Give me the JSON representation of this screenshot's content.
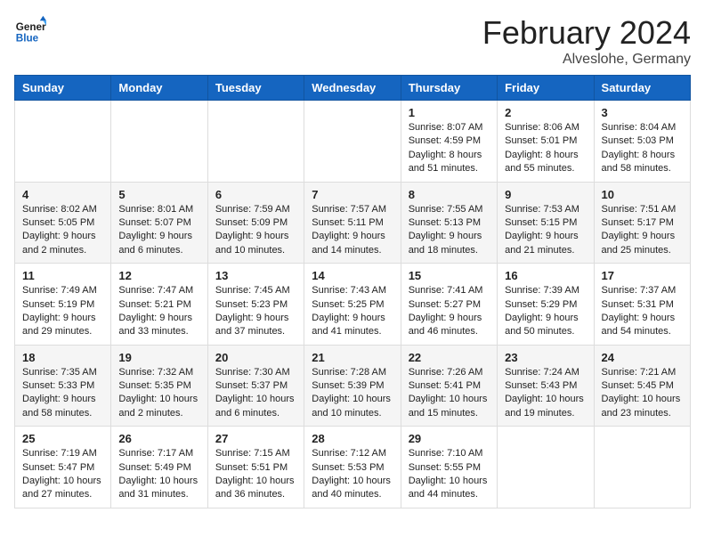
{
  "header": {
    "logo_general": "General",
    "logo_blue": "Blue",
    "month_title": "February 2024",
    "location": "Alveslohe, Germany"
  },
  "weekdays": [
    "Sunday",
    "Monday",
    "Tuesday",
    "Wednesday",
    "Thursday",
    "Friday",
    "Saturday"
  ],
  "weeks": [
    [
      {
        "day": "",
        "info": ""
      },
      {
        "day": "",
        "info": ""
      },
      {
        "day": "",
        "info": ""
      },
      {
        "day": "",
        "info": ""
      },
      {
        "day": "1",
        "info": "Sunrise: 8:07 AM\nSunset: 4:59 PM\nDaylight: 8 hours\nand 51 minutes."
      },
      {
        "day": "2",
        "info": "Sunrise: 8:06 AM\nSunset: 5:01 PM\nDaylight: 8 hours\nand 55 minutes."
      },
      {
        "day": "3",
        "info": "Sunrise: 8:04 AM\nSunset: 5:03 PM\nDaylight: 8 hours\nand 58 minutes."
      }
    ],
    [
      {
        "day": "4",
        "info": "Sunrise: 8:02 AM\nSunset: 5:05 PM\nDaylight: 9 hours\nand 2 minutes."
      },
      {
        "day": "5",
        "info": "Sunrise: 8:01 AM\nSunset: 5:07 PM\nDaylight: 9 hours\nand 6 minutes."
      },
      {
        "day": "6",
        "info": "Sunrise: 7:59 AM\nSunset: 5:09 PM\nDaylight: 9 hours\nand 10 minutes."
      },
      {
        "day": "7",
        "info": "Sunrise: 7:57 AM\nSunset: 5:11 PM\nDaylight: 9 hours\nand 14 minutes."
      },
      {
        "day": "8",
        "info": "Sunrise: 7:55 AM\nSunset: 5:13 PM\nDaylight: 9 hours\nand 18 minutes."
      },
      {
        "day": "9",
        "info": "Sunrise: 7:53 AM\nSunset: 5:15 PM\nDaylight: 9 hours\nand 21 minutes."
      },
      {
        "day": "10",
        "info": "Sunrise: 7:51 AM\nSunset: 5:17 PM\nDaylight: 9 hours\nand 25 minutes."
      }
    ],
    [
      {
        "day": "11",
        "info": "Sunrise: 7:49 AM\nSunset: 5:19 PM\nDaylight: 9 hours\nand 29 minutes."
      },
      {
        "day": "12",
        "info": "Sunrise: 7:47 AM\nSunset: 5:21 PM\nDaylight: 9 hours\nand 33 minutes."
      },
      {
        "day": "13",
        "info": "Sunrise: 7:45 AM\nSunset: 5:23 PM\nDaylight: 9 hours\nand 37 minutes."
      },
      {
        "day": "14",
        "info": "Sunrise: 7:43 AM\nSunset: 5:25 PM\nDaylight: 9 hours\nand 41 minutes."
      },
      {
        "day": "15",
        "info": "Sunrise: 7:41 AM\nSunset: 5:27 PM\nDaylight: 9 hours\nand 46 minutes."
      },
      {
        "day": "16",
        "info": "Sunrise: 7:39 AM\nSunset: 5:29 PM\nDaylight: 9 hours\nand 50 minutes."
      },
      {
        "day": "17",
        "info": "Sunrise: 7:37 AM\nSunset: 5:31 PM\nDaylight: 9 hours\nand 54 minutes."
      }
    ],
    [
      {
        "day": "18",
        "info": "Sunrise: 7:35 AM\nSunset: 5:33 PM\nDaylight: 9 hours\nand 58 minutes."
      },
      {
        "day": "19",
        "info": "Sunrise: 7:32 AM\nSunset: 5:35 PM\nDaylight: 10 hours\nand 2 minutes."
      },
      {
        "day": "20",
        "info": "Sunrise: 7:30 AM\nSunset: 5:37 PM\nDaylight: 10 hours\nand 6 minutes."
      },
      {
        "day": "21",
        "info": "Sunrise: 7:28 AM\nSunset: 5:39 PM\nDaylight: 10 hours\nand 10 minutes."
      },
      {
        "day": "22",
        "info": "Sunrise: 7:26 AM\nSunset: 5:41 PM\nDaylight: 10 hours\nand 15 minutes."
      },
      {
        "day": "23",
        "info": "Sunrise: 7:24 AM\nSunset: 5:43 PM\nDaylight: 10 hours\nand 19 minutes."
      },
      {
        "day": "24",
        "info": "Sunrise: 7:21 AM\nSunset: 5:45 PM\nDaylight: 10 hours\nand 23 minutes."
      }
    ],
    [
      {
        "day": "25",
        "info": "Sunrise: 7:19 AM\nSunset: 5:47 PM\nDaylight: 10 hours\nand 27 minutes."
      },
      {
        "day": "26",
        "info": "Sunrise: 7:17 AM\nSunset: 5:49 PM\nDaylight: 10 hours\nand 31 minutes."
      },
      {
        "day": "27",
        "info": "Sunrise: 7:15 AM\nSunset: 5:51 PM\nDaylight: 10 hours\nand 36 minutes."
      },
      {
        "day": "28",
        "info": "Sunrise: 7:12 AM\nSunset: 5:53 PM\nDaylight: 10 hours\nand 40 minutes."
      },
      {
        "day": "29",
        "info": "Sunrise: 7:10 AM\nSunset: 5:55 PM\nDaylight: 10 hours\nand 44 minutes."
      },
      {
        "day": "",
        "info": ""
      },
      {
        "day": "",
        "info": ""
      }
    ]
  ]
}
